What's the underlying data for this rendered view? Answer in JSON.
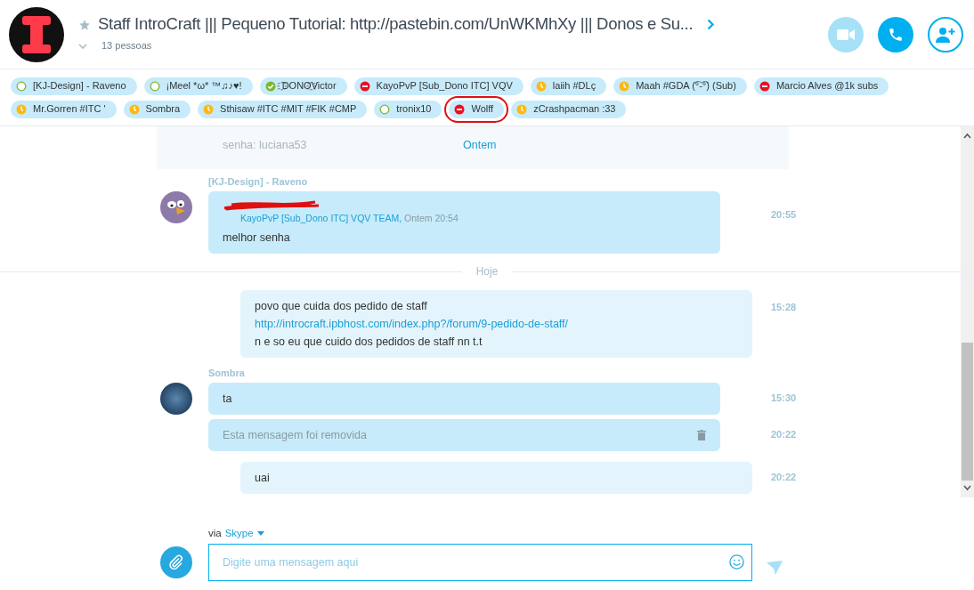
{
  "header": {
    "title": "Staff IntroCraft ||| Pequeno Tutorial: http://pastebin.com/UnWKMhXy ||| Donos e Su...",
    "favorite": false,
    "members": "13 pessoas"
  },
  "participants": [
    {
      "name": "[KJ-Design] - Raveno",
      "kind": "offline",
      "circled": false
    },
    {
      "name": "¡Meel *ω* ™♫♪♥!",
      "kind": "offline",
      "circled": false
    },
    {
      "name": "҈DONO҈Victor",
      "kind": "online",
      "circled": false
    },
    {
      "name": "KayoPvP [Sub_Dono ITC] VQV",
      "kind": "busy",
      "circled": false
    },
    {
      "name": "laiih #DLç",
      "kind": "away",
      "circled": false
    },
    {
      "name": "Maah #GDA (͡°-͡°) (Sub)",
      "kind": "away",
      "circled": false
    },
    {
      "name": "Marcio Alves @1k subs",
      "kind": "busy",
      "circled": false
    },
    {
      "name": "Mr.Gorren #ITC '",
      "kind": "away",
      "circled": false
    },
    {
      "name": "Sombra",
      "kind": "away",
      "circled": false
    },
    {
      "name": "Sthisaw #ITC #MIT #FIK #CMP",
      "kind": "away",
      "circled": false
    },
    {
      "name": "tronix10",
      "kind": "offline",
      "circled": false
    },
    {
      "name": "Wolff",
      "kind": "busy",
      "circled": true
    },
    {
      "name": "zCrashpacman :33",
      "kind": "away",
      "circled": false
    }
  ],
  "chat": [
    {
      "kind": "faded",
      "text": "senha: luciana53",
      "date": "Ontem"
    },
    {
      "kind": "incoming",
      "sender": "[KJ-Design] - Raveno",
      "avatar": {
        "kind": "bird"
      },
      "time": "20:55",
      "quote": {
        "author": "KayoPvP [Sub_Dono ITC] VQV TEAM,",
        "when": "Ontem 20:54"
      },
      "lines": [
        "melhor senha"
      ]
    },
    {
      "kind": "divider",
      "text": "Hoje"
    },
    {
      "kind": "outgoing",
      "time": "15:28",
      "lines": [
        "povo que cuida dos pedido de staff"
      ],
      "link": "http://introcraft.ipbhost.com/index.php?/forum/9-pedido-de-staff/",
      "after": [
        "n e so eu que cuido dos pedidos de staff nn t.t"
      ]
    },
    {
      "kind": "incoming",
      "sender": "Sombra",
      "avatar": {
        "kind": "dark"
      },
      "time": "15:30",
      "lines": [
        "ta"
      ]
    },
    {
      "kind": "removed",
      "time": "20:22",
      "text": "Esta mensagem foi removida"
    },
    {
      "kind": "outgoing",
      "time": "20:22",
      "lines": [
        "uai"
      ]
    }
  ],
  "composer": {
    "via": "via",
    "service": "Skype",
    "placeholder": "Digite uma mensagem aqui"
  }
}
